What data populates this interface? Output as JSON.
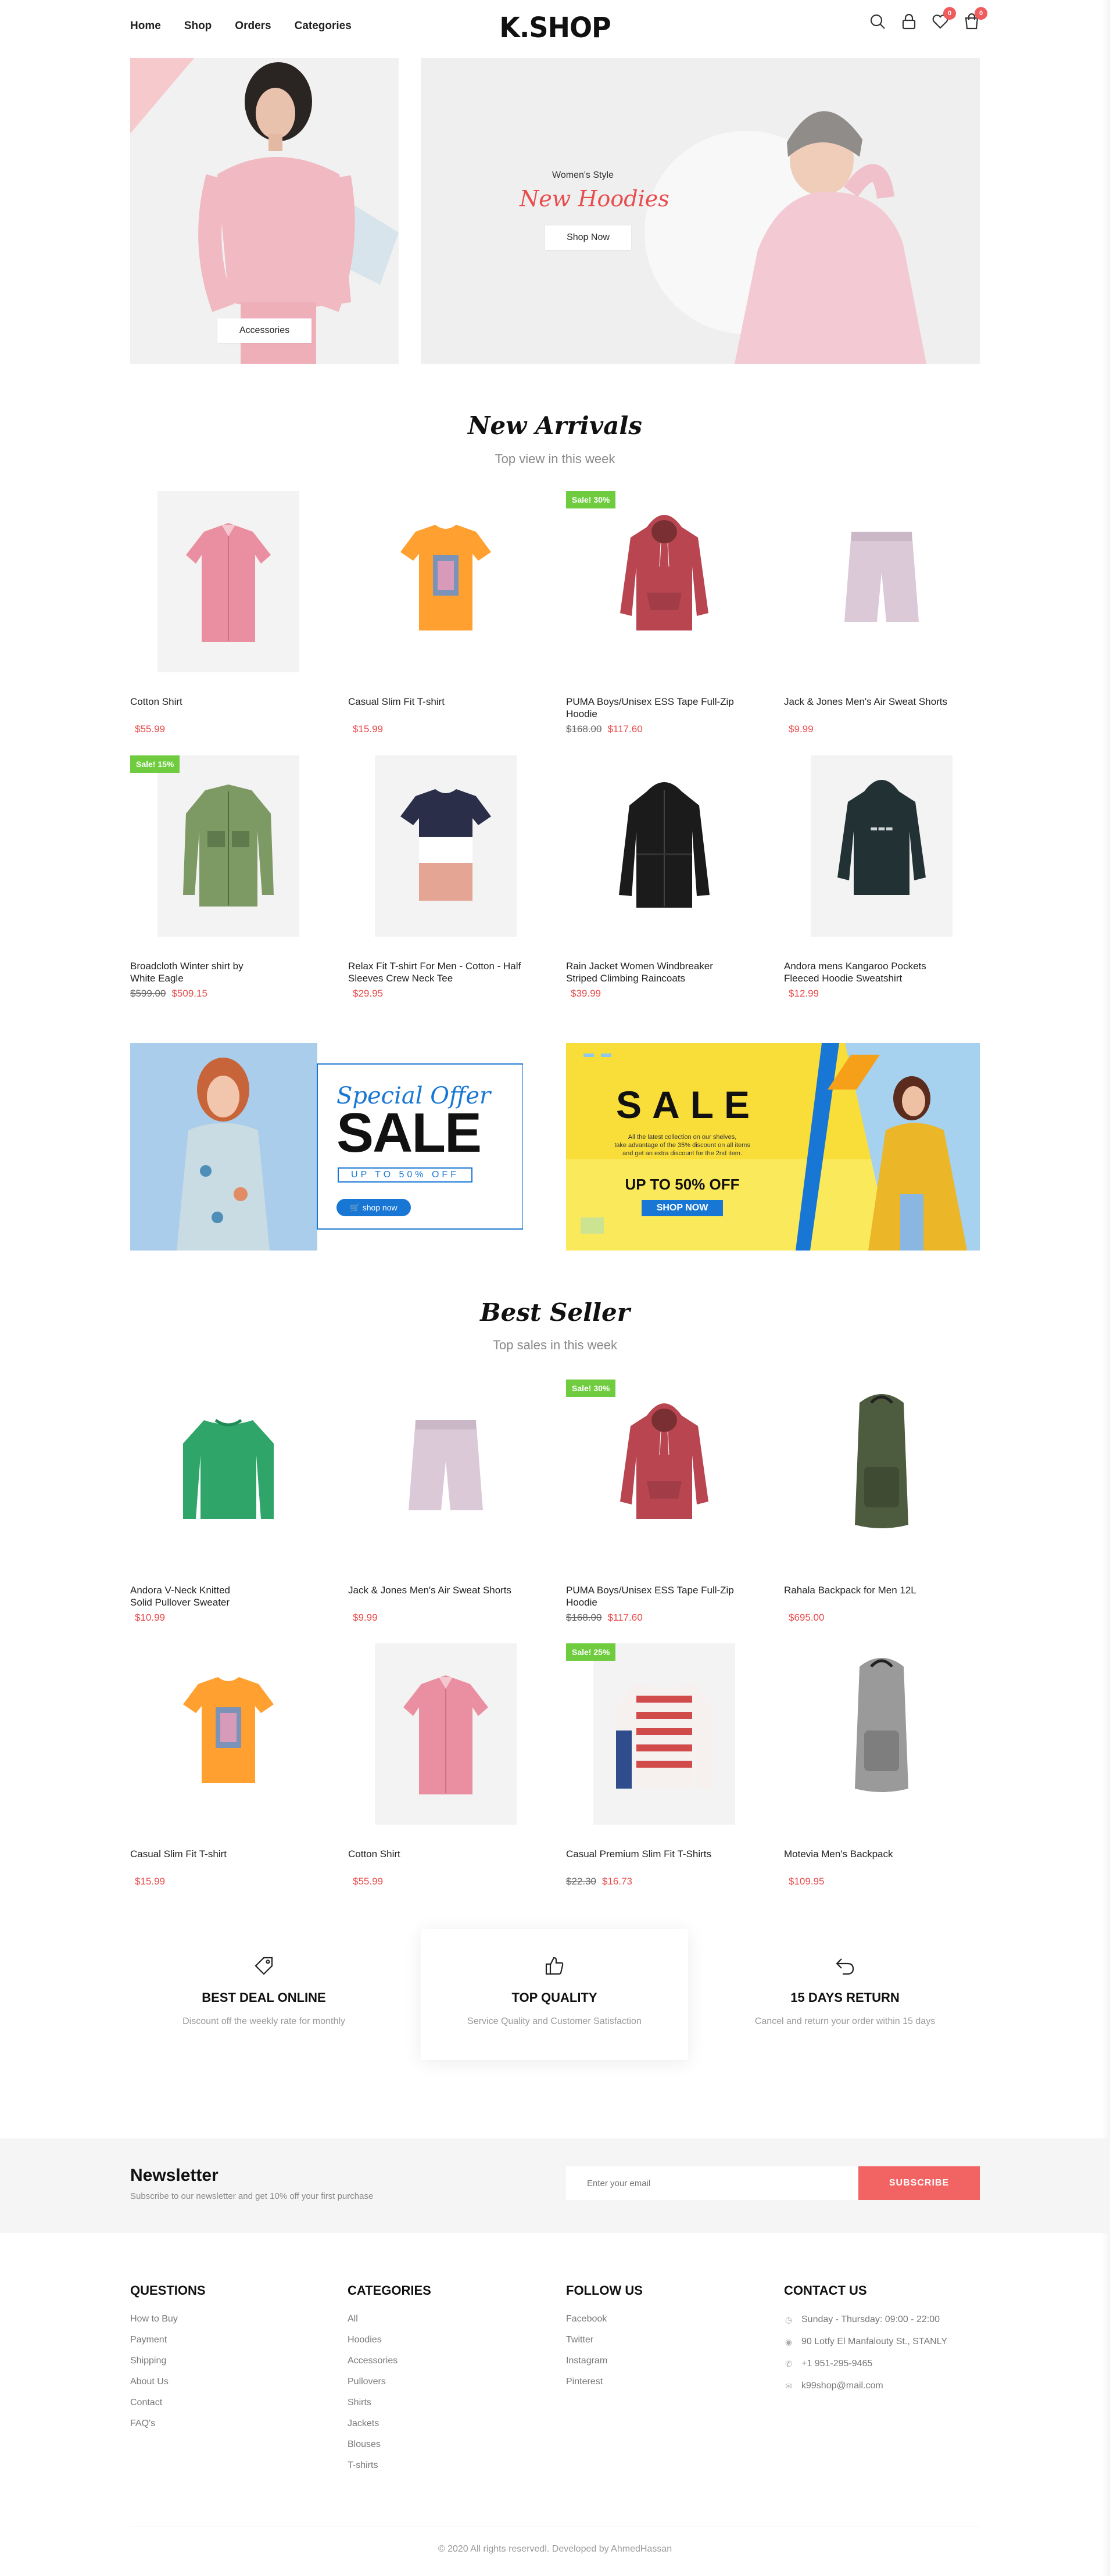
{
  "header": {
    "nav": [
      "Home",
      "Shop",
      "Orders",
      "Categories"
    ],
    "logo": "K.SHOP",
    "icons": [
      "search-icon",
      "user-lock-icon",
      "heart-icon",
      "cart-icon"
    ],
    "wishlist_count": "0",
    "cart_count": "0"
  },
  "hero": {
    "left_button": "Accessories",
    "right_kicker": "Women's Style",
    "right_title": "New Hoodies",
    "right_button": "Shop Now"
  },
  "new_arrivals": {
    "title": "New Arrivals",
    "subtitle": "Top view in this week",
    "products": [
      {
        "name": "Cotton Shirt",
        "price": "$55.99",
        "old_price": "",
        "badge": ""
      },
      {
        "name": "Casual Slim Fit T-shirt",
        "price": "$15.99",
        "old_price": "",
        "badge": ""
      },
      {
        "name": "PUMA Boys/Unisex ESS Tape Full-Zip Hoodie",
        "price": "$117.60",
        "old_price": "$168.00",
        "badge": "Sale! 30%"
      },
      {
        "name": "Jack & Jones Men's Air Sweat Shorts",
        "price": "$9.99",
        "old_price": "",
        "badge": ""
      },
      {
        "name": "Broadcloth Winter shirt by White Eagle",
        "price": "$509.15",
        "old_price": "$599.00",
        "badge": "Sale! 15%"
      },
      {
        "name": "Relax Fit T-shirt For Men - Cotton - Half Sleeves Crew Neck Tee",
        "price": "$29.95",
        "old_price": "",
        "badge": ""
      },
      {
        "name": "Rain Jacket Women Windbreaker Striped Climbing Raincoats",
        "price": "$39.99",
        "old_price": "",
        "badge": ""
      },
      {
        "name": "Andora mens Kangaroo Pockets Fleeced Hoodie Sweatshirt",
        "price": "$12.99",
        "old_price": "",
        "badge": ""
      }
    ]
  },
  "promo": {
    "left_script": "Special Offer",
    "left_title": "SALE",
    "left_sub": "UP TO 50% OFF",
    "left_button": "shop now",
    "right_title": "SALE",
    "right_text_1": "All the latest collection on our shelves,",
    "right_text_2": "take advantage of the 35% discount on all items",
    "right_text_3": "and get an extra discount for the 2nd item.",
    "right_offer": "UP TO 50% OFF",
    "right_button": "SHOP NOW"
  },
  "best_seller": {
    "title": "Best Seller",
    "subtitle": "Top sales in this week",
    "products": [
      {
        "name": "Andora V-Neck Knitted Solid Pullover Sweater",
        "price": "$10.99",
        "old_price": "",
        "badge": ""
      },
      {
        "name": "Jack & Jones Men's Air Sweat Shorts",
        "price": "$9.99",
        "old_price": "",
        "badge": ""
      },
      {
        "name": "PUMA Boys/Unisex ESS Tape Full-Zip Hoodie",
        "price": "$117.60",
        "old_price": "$168.00",
        "badge": "Sale! 30%"
      },
      {
        "name": "Rahala Backpack for Men 12L",
        "price": "$695.00",
        "old_price": "",
        "badge": ""
      },
      {
        "name": "Casual Slim Fit T-shirt",
        "price": "$15.99",
        "old_price": "",
        "badge": ""
      },
      {
        "name": "Cotton Shirt",
        "price": "$55.99",
        "old_price": "",
        "badge": ""
      },
      {
        "name": "Casual Premium Slim Fit T-Shirts",
        "price": "$16.73",
        "old_price": "$22.30",
        "badge": "Sale! 25%"
      },
      {
        "name": "Motevia Men's Backpack",
        "price": "$109.95",
        "old_price": "",
        "badge": ""
      }
    ]
  },
  "features": [
    {
      "title": "BEST DEAL ONLINE",
      "desc": "Discount off the weekly rate for monthly",
      "icon": "tag-icon"
    },
    {
      "title": "TOP QUALITY",
      "desc": "Service Quality and Customer Satisfaction",
      "icon": "thumbs-up-icon"
    },
    {
      "title": "15 DAYS RETURN",
      "desc": "Cancel and return your order within 15 days",
      "icon": "return-arrow-icon"
    }
  ],
  "newsletter": {
    "title": "Newsletter",
    "subtitle": "Subscribe to our newsletter and get 10% off your first purchase",
    "placeholder": "Enter your email",
    "button": "SUBSCRIBE"
  },
  "footer": {
    "questions_title": "QUESTIONS",
    "questions": [
      "How to Buy",
      "Payment",
      "Shipping",
      "About Us",
      "Contact",
      "FAQ's"
    ],
    "categories_title": "CATEGORIES",
    "categories": [
      "All",
      "Hoodies",
      "Accessories",
      "Pullovers",
      "Shirts",
      "Jackets",
      "Blouses",
      "T-shirts"
    ],
    "follow_title": "FOLLOW US",
    "follow": [
      "Facebook",
      "Twitter",
      "Instagram",
      "Pinterest"
    ],
    "contact_title": "CONTACT US",
    "contact": [
      {
        "icon": "clock-icon",
        "text": "Sunday - Thursday: 09:00 - 22:00"
      },
      {
        "icon": "location-pin-icon",
        "text": "90 Lotfy El Manfalouty St., STANLY"
      },
      {
        "icon": "phone-icon",
        "text": "+1 951-295-9465"
      },
      {
        "icon": "mail-icon",
        "text": "k99shop@mail.com"
      }
    ],
    "copyright": "© 2020 All rights reservedl. Developed by AhmedHassan"
  },
  "colors": {
    "accent": "#e94c4c",
    "sale_badge": "#6fcc3e",
    "subscribe": "#f26464",
    "promo_blue": "#1877d4",
    "promo_yellow": "#f9de3a"
  }
}
